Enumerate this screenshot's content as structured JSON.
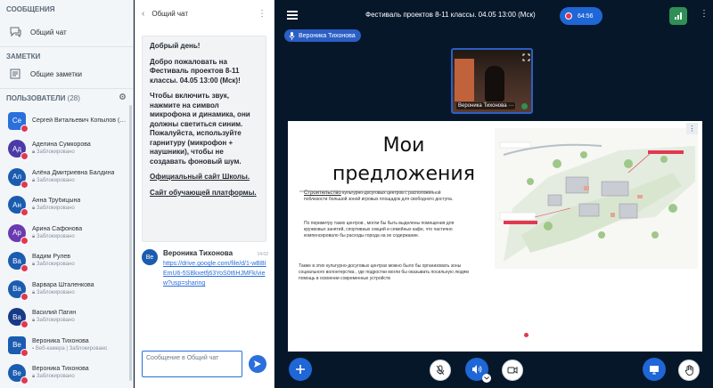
{
  "sidebar": {
    "messages_header": "СООБЩЕНИЯ",
    "public_chat_label": "Общий чат",
    "notes_header": "ЗАМЕТКИ",
    "shared_notes_label": "Общие заметки",
    "users_header": "ПОЛЬЗОВАТЕЛИ",
    "users_count": "(28)",
    "users": [
      {
        "initials": "Се",
        "name": "Сергей Витальевич Копылов (Ва…",
        "status": "",
        "color": "#2a6fdc",
        "square": true
      },
      {
        "initials": "Ад",
        "name": "Аделина Сумкорова",
        "status": "Заблокировано",
        "color": "#4a3aa8",
        "square": false
      },
      {
        "initials": "Ал",
        "name": "Алёна Дмитриевна Балдина",
        "status": "Заблокировано",
        "color": "#1b5cb0",
        "square": false
      },
      {
        "initials": "Ан",
        "name": "Анна Трубицына",
        "status": "Заблокировано",
        "color": "#1b5cb0",
        "square": false
      },
      {
        "initials": "Ар",
        "name": "Арина Сафонова",
        "status": "Заблокировано",
        "color": "#6a3ab0",
        "square": false
      },
      {
        "initials": "Ва",
        "name": "Вадим Рулев",
        "status": "Заблокировано",
        "color": "#1b5cb0",
        "square": false
      },
      {
        "initials": "Ва",
        "name": "Варвара Шталенкова",
        "status": "Заблокировано",
        "color": "#1b5cb0",
        "square": false
      },
      {
        "initials": "Ва",
        "name": "Василий Пагин",
        "status": "Заблокировано",
        "color": "#173a88",
        "square": false
      },
      {
        "initials": "Ве",
        "name": "Вероника Тихонова",
        "status": "Веб-камера | Заблокировано",
        "color": "#1b5cb0",
        "square": true
      },
      {
        "initials": "Ве",
        "name": "Вероника Тихонова",
        "status": "Заблокировано",
        "color": "#1b5cb0",
        "square": false
      }
    ]
  },
  "chat": {
    "title": "Общий чат",
    "welcome": {
      "p1": "Добрый день!",
      "p2": "Добро пожаловать на Фестиваль проектов 8-11 классы. 04.05 13:00 (Мск)!",
      "p3": "Чтобы включить звук, нажмите на символ микрофона и динамика, они должны светиться синим. Пожалуйста, используйте гарнитуру (микрофон + наушники), чтобы не создавать фоновый шум.",
      "link1": "Официальный сайт Школы.",
      "link2": "Сайт обучающей платформы."
    },
    "message": {
      "avatar": "Ве",
      "author": "Вероника Тихонова",
      "time": "14:02",
      "link": "https://drive.google.com/file/d/1-wBBIEmU6-5SBkxetfj63YoS0t6HJMFk/view?usp=sharing"
    },
    "input_placeholder": "Сообщение в Общий чат"
  },
  "meeting": {
    "title": "Фестиваль проектов 8-11 классы. 04.05 13:00 (Мск)",
    "recording_time": "64:56",
    "talking_user": "Вероника Тихонова",
    "video_label": "Вероника Тихонова"
  },
  "slide": {
    "title": "Мои предложения",
    "paragraph1_lead": "Строительство",
    "paragraph1": "культурно-досуговых центров с расположенной поблизости большой зоной игровых площадок для свободного доступа.",
    "paragraph2": "По периметру таких центров , могли бы быть выделены помещения для кружковых занятий, спортивных секций и семейных кафе, что частично компенсировало бы расходы города на их содержание.",
    "paragraph3": "Также в этих культурно-досуговых центрах можно было бы организовать зоны социального волонтерства , где подростки могли бы оказывать посильную людям помощь в освоении современных устройств"
  },
  "colors": {
    "accent": "#2a6fdc",
    "background": "#06172a",
    "mic_off": "#e2384f"
  }
}
